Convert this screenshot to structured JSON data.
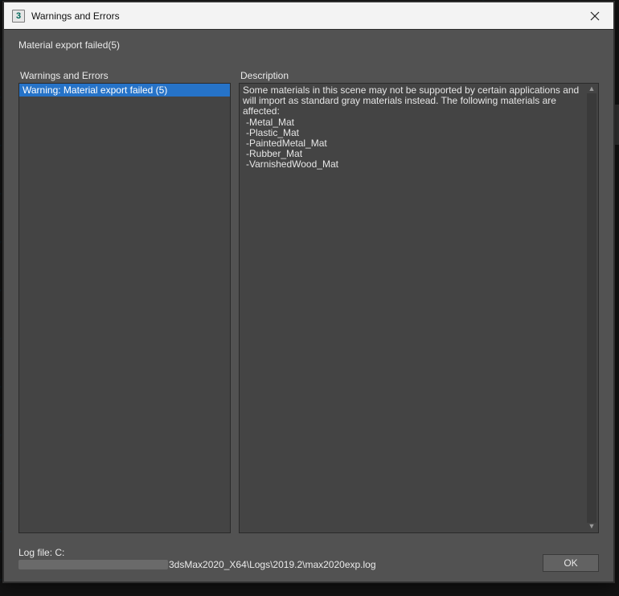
{
  "window": {
    "app_icon_glyph": "3",
    "title": "Warnings and Errors"
  },
  "subtitle": "Material export failed(5)",
  "left_pane": {
    "label": "Warnings and Errors",
    "items": [
      {
        "text": "Warning: Material export failed (5)",
        "selected": true
      }
    ]
  },
  "right_pane": {
    "label": "Description",
    "intro": "Some materials in this scene may not be supported by certain applications and will import as standard gray materials instead. The following materials are affected:",
    "materials": [
      "Metal_Mat",
      "Plastic_Mat",
      "PaintedMetal_Mat",
      "Rubber_Mat",
      "VarnishedWood_Mat"
    ]
  },
  "footer": {
    "log_label": "Log file: C:",
    "log_path_visible_tail": "3dsMax2020_X64\\Logs\\2019.2\\max2020exp.log",
    "ok_label": "OK"
  }
}
